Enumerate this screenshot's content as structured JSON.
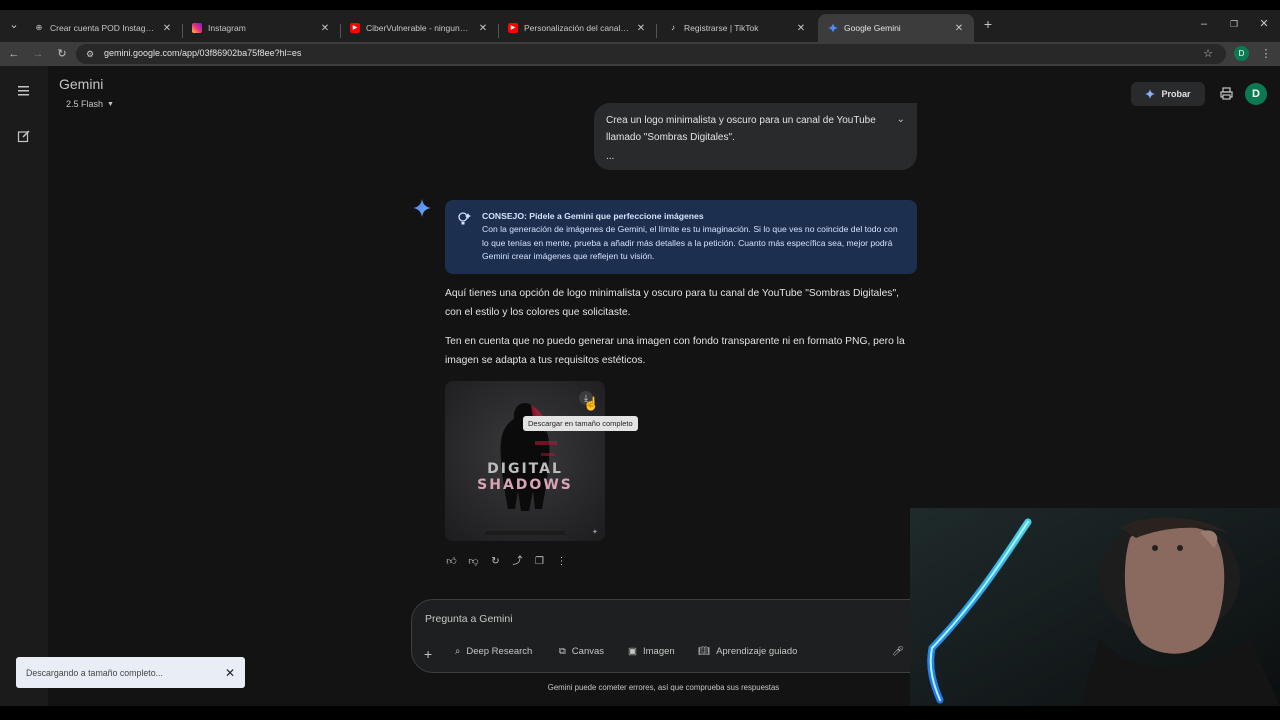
{
  "browser": {
    "tabs": [
      {
        "label": "Crear cuenta POD Instagram",
        "icon": "globe-icon"
      },
      {
        "label": "Instagram",
        "icon": "instagram-icon"
      },
      {
        "label": "CiberVulnerable - ninguna red",
        "icon": "youtube-icon"
      },
      {
        "label": "Personalización del canal - YouTube",
        "icon": "youtube-icon"
      },
      {
        "label": "Registrarse | TikTok",
        "icon": "tiktok-icon"
      },
      {
        "label": "Google Gemini",
        "icon": "gemini-icon",
        "active": true
      }
    ],
    "url": "gemini.google.com/app/03f86902ba75f8ee?hl=es",
    "profile_initial": "D"
  },
  "header": {
    "app_name": "Gemini",
    "model": "2.5 Flash",
    "try_button": "Probar",
    "avatar_initial": "D"
  },
  "conversation": {
    "user_prompt": "Crea un logo minimalista y oscuro para un canal de YouTube llamado \"Sombras Digitales\".",
    "user_prompt_more": "...",
    "tip": {
      "title": "CONSEJO: Pídele a Gemini que perfeccione imágenes",
      "body": "Con la generación de imágenes de Gemini, el límite es tu imaginación. Si lo que ves no coincide del todo con lo que tenías en mente, prueba a añadir más detalles a la petición. Cuanto más específica sea, mejor podrá Gemini crear imágenes que reflejen tu visión."
    },
    "response_p1": "Aquí tienes una opción de logo minimalista y oscuro para tu canal de YouTube \"Sombras Digitales\", con el estilo y los colores que solicitaste.",
    "response_p2": "Ten en cuenta que no puedo generar una imagen con fondo transparente ni en formato PNG, pero la imagen se adapta a tus requisitos estéticos.",
    "image_text_line1": "DIGITAL",
    "image_text_line2": "SHADOWS",
    "download_tooltip": "Descargar en tamaño completo"
  },
  "composer": {
    "placeholder": "Pregunta a Gemini",
    "tools": [
      "Deep Research",
      "Canvas",
      "Imagen",
      "Aprendizaje guiado"
    ]
  },
  "disclaimer": "Gemini puede cometer errores, así que comprueba sus respuestas",
  "toast": {
    "text": "Descargando a tamaño completo..."
  },
  "colors": {
    "background": "#131314",
    "tip_box": "#1c2f4f",
    "accent": "#4285f4",
    "avatar": "#0b7a52"
  }
}
